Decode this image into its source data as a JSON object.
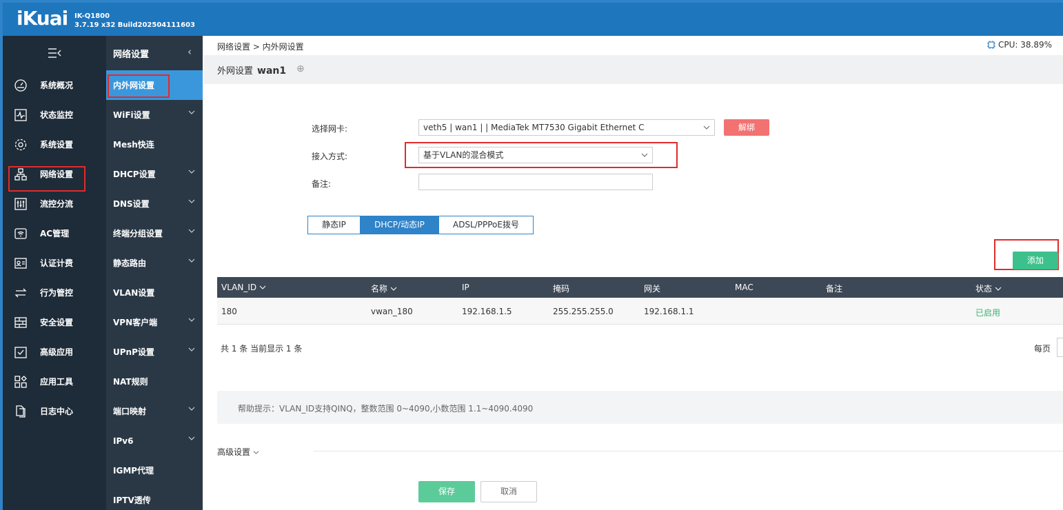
{
  "header": {
    "logo": "iKuai",
    "model": "IK-Q1800",
    "version": "3.7.19 x32 Build202504111603"
  },
  "colors": {
    "header_bg": "#1e76bd",
    "sidebar_bg": "#1e2b38",
    "subsidebar_bg": "#2a3846",
    "accent_blue": "#2f83c8",
    "add_green": "#3cc18c",
    "unbind_red": "#f27272",
    "highlight_red": "#e02b2b"
  },
  "sidebar": {
    "toggle_icon": "menu-collapse-icon",
    "items": [
      {
        "label": "系统概况",
        "icon": "dashboard-gauge-icon"
      },
      {
        "label": "状态监控",
        "icon": "pulse-monitor-icon"
      },
      {
        "label": "系统设置",
        "icon": "gear-icon"
      },
      {
        "label": "网络设置",
        "icon": "network-tree-icon"
      },
      {
        "label": "流控分流",
        "icon": "sliders-icon"
      },
      {
        "label": "AC管理",
        "icon": "wifi-ap-icon"
      },
      {
        "label": "认证计费",
        "icon": "id-card-icon"
      },
      {
        "label": "行为管控",
        "icon": "swap-arrows-icon"
      },
      {
        "label": "安全设置",
        "icon": "firewall-icon"
      },
      {
        "label": "高级应用",
        "icon": "check-box-icon"
      },
      {
        "label": "应用工具",
        "icon": "apps-grid-icon"
      },
      {
        "label": "日志中心",
        "icon": "document-copy-icon"
      }
    ]
  },
  "subsidebar": {
    "title": "网络设置",
    "items": [
      {
        "label": "内外网设置",
        "has_chevron": false
      },
      {
        "label": "WiFi设置",
        "has_chevron": true
      },
      {
        "label": "Mesh快连",
        "has_chevron": false
      },
      {
        "label": "DHCP设置",
        "has_chevron": true
      },
      {
        "label": "DNS设置",
        "has_chevron": true
      },
      {
        "label": "终端分组设置",
        "has_chevron": true
      },
      {
        "label": "静态路由",
        "has_chevron": true
      },
      {
        "label": "VLAN设置",
        "has_chevron": false
      },
      {
        "label": "VPN客户端",
        "has_chevron": true
      },
      {
        "label": "UPnP设置",
        "has_chevron": true
      },
      {
        "label": "NAT规则",
        "has_chevron": false
      },
      {
        "label": "端口映射",
        "has_chevron": true
      },
      {
        "label": "IPv6",
        "has_chevron": true
      },
      {
        "label": "IGMP代理",
        "has_chevron": false
      },
      {
        "label": "IPTV透传",
        "has_chevron": false
      }
    ]
  },
  "breadcrumb": "网络设置 > 内外网设置",
  "cpu": "CPU: 38.89%",
  "subheader": {
    "label": "外网设置",
    "name": "wan1"
  },
  "form": {
    "nic_label": "选择网卡:",
    "nic_value": "veth5 | wan1 |                            | MediaTek MT7530 Gigabit Ethernet C",
    "unbind": "解绑",
    "access_label": "接入方式:",
    "access_value": "基于VLAN的混合模式",
    "remark_label": "备注:",
    "remark_value": ""
  },
  "tabs": [
    {
      "label": "静态IP",
      "active": false
    },
    {
      "label": "DHCP/动态IP",
      "active": true
    },
    {
      "label": "ADSL/PPPoE拨号",
      "active": false
    }
  ],
  "add_button": "添加",
  "table": {
    "headers": [
      "VLAN_ID",
      "名称",
      "IP",
      "掩码",
      "网关",
      "MAC",
      "备注",
      "状态"
    ],
    "rows": [
      [
        "180",
        "vwan_180",
        "192.168.1.5",
        "255.255.255.0",
        "192.168.1.1",
        "",
        "",
        "已启用"
      ]
    ]
  },
  "pagination": {
    "count_text": "共 1 条 当前显示 1 条",
    "per_page": "每页"
  },
  "help": "帮助提示：VLAN_ID支持QINQ，整数范围 0~4090,小数范围 1.1~4090.4090",
  "advanced": "高级设置",
  "save": "保存",
  "cancel": "取消"
}
